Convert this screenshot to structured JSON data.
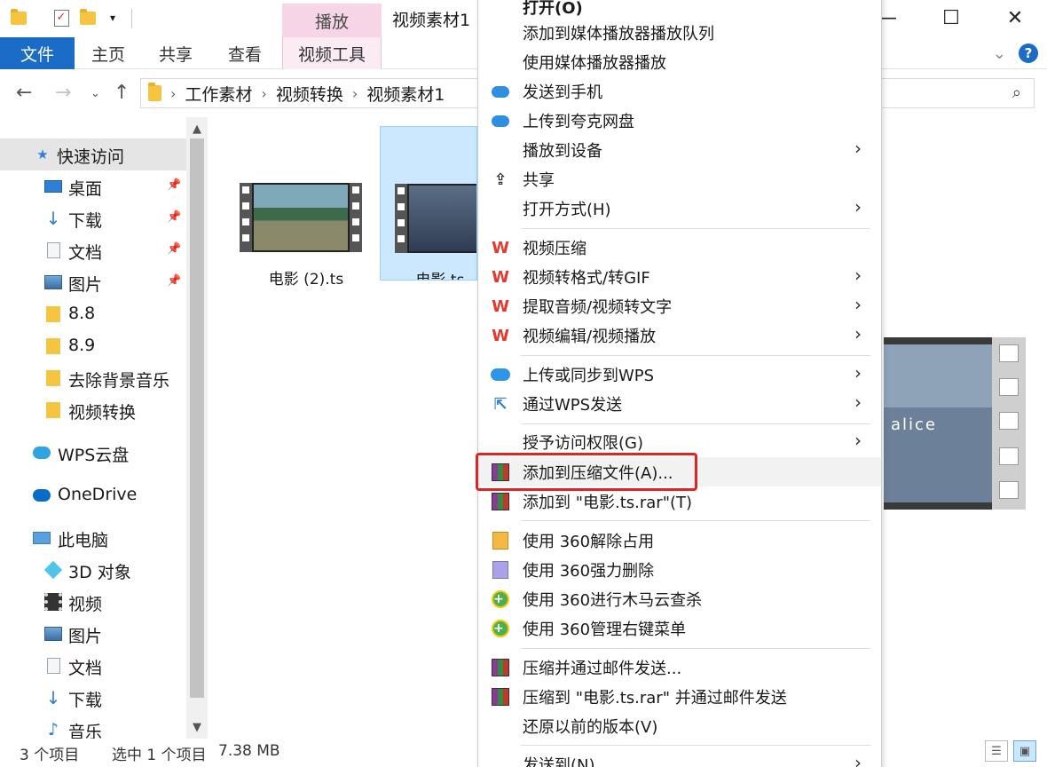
{
  "window": {
    "title": "视频素材1",
    "context_tab_header": "播放",
    "controls": {
      "minimize": "—",
      "maximize": "☐",
      "close": "✕"
    }
  },
  "ribbon": {
    "tabs": [
      "文件",
      "主页",
      "共享",
      "查看",
      "视频工具"
    ]
  },
  "address": {
    "breadcrumbs": [
      "工作素材",
      "视频转换",
      "视频素材1"
    ]
  },
  "nav": {
    "items": [
      {
        "label": "快速访问",
        "icon": "star-icon"
      },
      {
        "label": "桌面",
        "icon": "desktop-icon",
        "pinned": true
      },
      {
        "label": "下载",
        "icon": "download-icon",
        "pinned": true
      },
      {
        "label": "文档",
        "icon": "document-icon",
        "pinned": true
      },
      {
        "label": "图片",
        "icon": "picture-icon",
        "pinned": true
      },
      {
        "label": "8.8",
        "icon": "folder-icon"
      },
      {
        "label": "8.9",
        "icon": "folder-icon"
      },
      {
        "label": "去除背景音乐",
        "icon": "folder-icon"
      },
      {
        "label": "视频转换",
        "icon": "folder-icon"
      },
      {
        "label": "WPS云盘",
        "icon": "wps-cloud-icon"
      },
      {
        "label": "OneDrive",
        "icon": "onedrive-icon"
      },
      {
        "label": "此电脑",
        "icon": "computer-icon"
      },
      {
        "label": "3D 对象",
        "icon": "3d-objects-icon"
      },
      {
        "label": "视频",
        "icon": "video-icon"
      },
      {
        "label": "图片",
        "icon": "picture-icon"
      },
      {
        "label": "文档",
        "icon": "document-icon"
      },
      {
        "label": "下载",
        "icon": "download-icon"
      },
      {
        "label": "音乐",
        "icon": "music-icon"
      }
    ]
  },
  "files": [
    {
      "name": "电影 (2).ts",
      "selected": false
    },
    {
      "name": "电影.ts",
      "selected": true
    }
  ],
  "preview": {
    "overlay_text": "alice"
  },
  "status": {
    "item_count": "3 个项目",
    "selection": "选中 1 个项目",
    "size": "7.38 MB"
  },
  "context_menu": {
    "items": [
      {
        "label": "打开(O)",
        "icon": ""
      },
      {
        "label": "添加到媒体播放器播放队列",
        "icon": ""
      },
      {
        "label": "使用媒体播放器播放",
        "icon": ""
      },
      {
        "label": "发送到手机",
        "icon": "quark-cloud-icon"
      },
      {
        "label": "上传到夸克网盘",
        "icon": "quark-cloud-icon"
      },
      {
        "label": "播放到设备",
        "icon": "",
        "submenu": true
      },
      {
        "label": "共享",
        "icon": "share-icon"
      },
      {
        "label": "打开方式(H)",
        "icon": "",
        "submenu": true
      },
      {
        "label": "视频压缩",
        "icon": "wps-icon"
      },
      {
        "label": "视频转格式/转GIF",
        "icon": "wps-icon",
        "submenu": true
      },
      {
        "label": "提取音频/视频转文字",
        "icon": "wps-icon",
        "submenu": true
      },
      {
        "label": "视频编辑/视频播放",
        "icon": "wps-icon",
        "submenu": true
      },
      {
        "label": "上传或同步到WPS",
        "icon": "wps-cloud-icon",
        "submenu": true
      },
      {
        "label": "通过WPS发送",
        "icon": "wps-send-icon",
        "submenu": true
      },
      {
        "label": "授予访问权限(G)",
        "icon": "",
        "submenu": true
      },
      {
        "label": "添加到压缩文件(A)...",
        "icon": "winrar-icon",
        "highlighted": true
      },
      {
        "label": "添加到 \"电影.ts.rar\"(T)",
        "icon": "winrar-icon"
      },
      {
        "label": "使用 360解除占用",
        "icon": "360-unlock-icon"
      },
      {
        "label": "使用 360强力删除",
        "icon": "360-shred-icon"
      },
      {
        "label": "使用 360进行木马云查杀",
        "icon": "360-scan-icon"
      },
      {
        "label": "使用 360管理右键菜单",
        "icon": "360-manage-icon"
      },
      {
        "label": "压缩并通过邮件发送...",
        "icon": "winrar-icon"
      },
      {
        "label": "压缩到 \"电影.ts.rar\" 并通过邮件发送",
        "icon": "winrar-icon"
      },
      {
        "label": "还原以前的版本(V)",
        "icon": ""
      },
      {
        "label": "发送到(N)",
        "icon": "",
        "submenu": true
      }
    ]
  },
  "colors": {
    "accent": "#1a6cc6",
    "context_tab": "#f6d5e6",
    "selection": "#cce8ff",
    "highlight_box": "#e02424"
  }
}
